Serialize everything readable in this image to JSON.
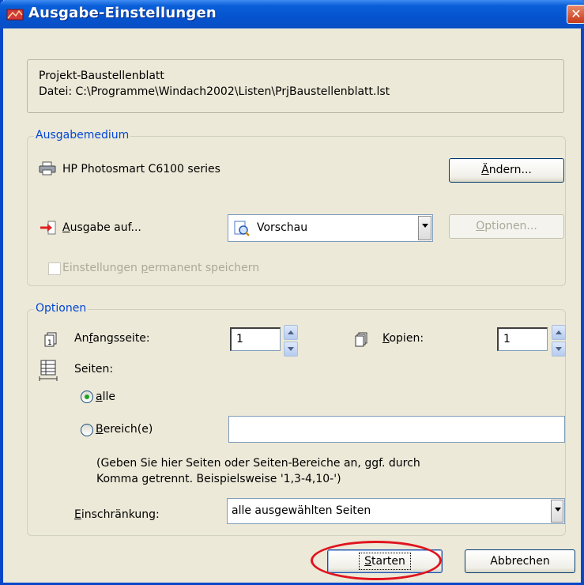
{
  "window": {
    "title": "Ausgabe-Einstellungen"
  },
  "info": {
    "project": "Projekt-Baustellenblatt",
    "file": "Datei: C:\\Programme\\Windach2002\\Listen\\PrjBaustellenblatt.lst"
  },
  "ausgabemedium": {
    "legend": "Ausgabemedium",
    "printer": "HP Photosmart C6100 series",
    "aendern_button": {
      "prefix": "",
      "mnemonic": "Ä",
      "rest": "ndern..."
    },
    "ausgabe_label": {
      "prefix": "",
      "mnemonic": "A",
      "rest": "usgabe auf..."
    },
    "ausgabe_select": "Vorschau",
    "optionen_button": {
      "prefix": "",
      "mnemonic": "O",
      "rest": "ptionen..."
    },
    "permanent_checkbox": {
      "prefix": "Einstellungen ",
      "mnemonic": "p",
      "rest": "ermanent speichern",
      "checked": false
    }
  },
  "optionen": {
    "legend": "Optionen",
    "anfangsseite_label": {
      "prefix": "An",
      "mnemonic": "f",
      "rest": "angsseite:"
    },
    "anfangsseite_value": "1",
    "kopien_label": {
      "prefix": "",
      "mnemonic": "K",
      "rest": "opien:"
    },
    "kopien_value": "1",
    "seiten_label": "Seiten:",
    "radio_alle": {
      "prefix": "",
      "mnemonic": "a",
      "rest": "lle",
      "checked": true
    },
    "radio_bereich": {
      "prefix": "",
      "mnemonic": "B",
      "rest": "ereich(e)",
      "checked": false
    },
    "bereich_value": "",
    "hint_line1": "(Geben Sie hier Seiten oder Seiten-Bereiche an, ggf. durch",
    "hint_line2": "Komma getrennt. Beispielsweise '1,3-4,10-')",
    "einschraenkung_label": {
      "prefix": "",
      "mnemonic": "E",
      "rest": "inschränkung:"
    },
    "einschraenkung_select": "alle ausgewählten Seiten"
  },
  "footer": {
    "starten_button": {
      "prefix": "",
      "mnemonic": "S",
      "rest": "tarten"
    },
    "abbrechen_button": "Abbrechen"
  }
}
